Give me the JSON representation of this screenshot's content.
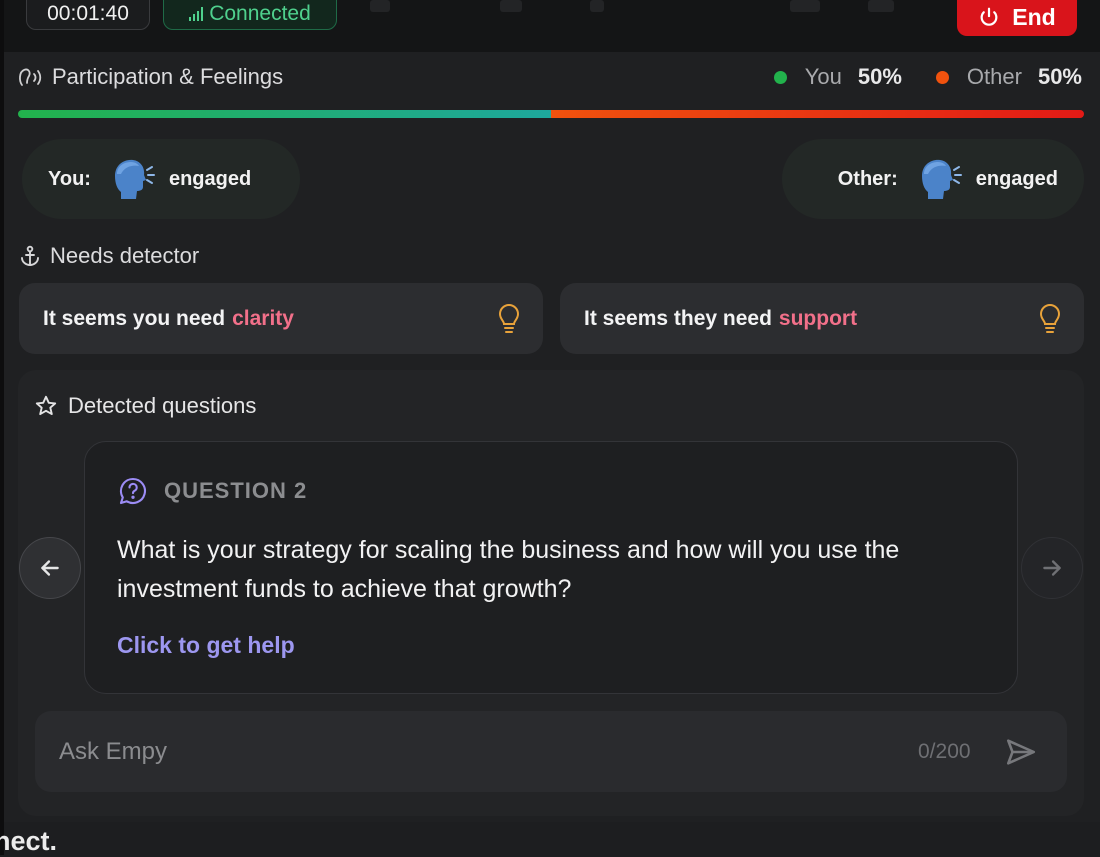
{
  "topbar": {
    "timer": "00:01:40",
    "connection_status": "Connected",
    "end_label": "End",
    "colors": {
      "end": "#d9141b",
      "connected": "#4fd08d"
    }
  },
  "participation": {
    "title": "Participation & Feelings",
    "you_label": "You",
    "you_pct": "50%",
    "other_label": "Other",
    "other_pct": "50%",
    "you_share": 0.5,
    "colors": {
      "you": "#22b24c",
      "other": "#f0520e"
    }
  },
  "moods": {
    "you_label": "You:",
    "you_state": "engaged",
    "other_label": "Other:",
    "other_state": "engaged",
    "icon": "speaking-head-icon"
  },
  "needs": {
    "title": "Needs detector",
    "you_prefix": "It seems you need",
    "you_need": "clarity",
    "they_prefix": "It seems they need",
    "they_need": "support",
    "icon": "lightbulb-icon",
    "highlight_color": "#f2708a"
  },
  "questions": {
    "title": "Detected questions",
    "label": "QUESTION 2",
    "text": "What is your strategy for scaling the business and how will you use the investment funds to achieve that growth?",
    "help_link": "Click to get help"
  },
  "ask": {
    "placeholder": "Ask Empy",
    "counter": "0/200"
  },
  "background_fragment": "nect."
}
